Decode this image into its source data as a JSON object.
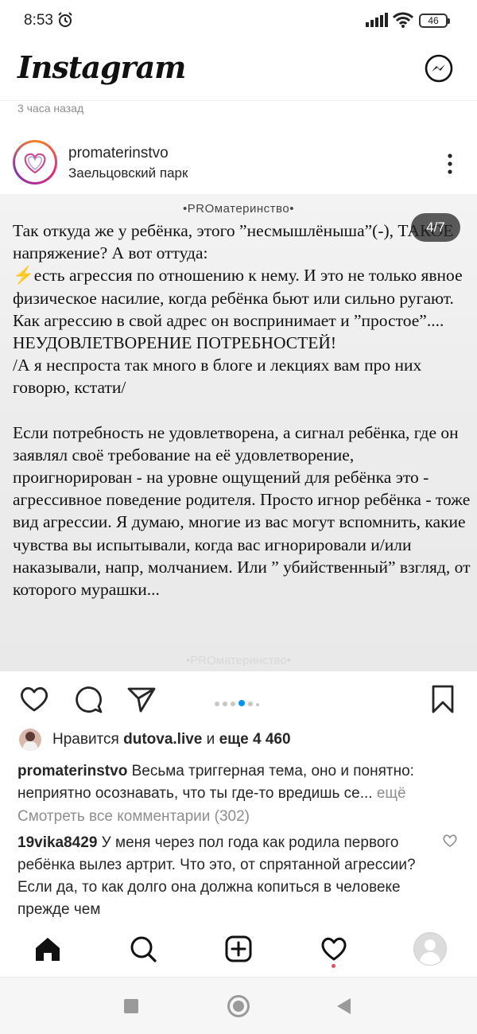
{
  "status_bar": {
    "time": "8:53",
    "battery": "46"
  },
  "header": {
    "app_name": "Instagram"
  },
  "post": {
    "time_ago": "3 часа назад",
    "username": "promaterinstvo",
    "location": "Заельцовский парк",
    "image": {
      "brand": "•PROматеринство•",
      "counter": "4/7",
      "paragraphs": [
        "Так откуда же у ребёнка, этого ”несмышлёныша”(-), ТАКОЕ напряжение? А вот оттуда:",
        "⚡есть агрессия по отношению к нему. И это не только явное физическое насилие, когда ребёнка бьют или сильно ругают. Как агрессию в свой адрес он воспринимает и ”простое”.... НЕУДОВЛЕТВОРЕНИЕ ПОТРЕБНОСТЕЙ!",
        "/А я неспроста так много в блоге и лекциях вам про них говорю, кстати/",
        "",
        "Если потребность не удовлетворена, а сигнал ребёнка, где он заявлял своё требование на её удовлетворение, проигнорирован - на уровне ощущений для ребёнка это - агрессивное поведение родителя. Просто игнор ребёнка - тоже вид агрессии. Я думаю, многие из вас могут вспомнить, какие чувства вы испытывали, когда вас игнорировали и/или наказывали, напр, молчанием. Или ” убийственный” взгляд, от которого мурашки..."
      ]
    },
    "likes": {
      "prefix": "Нравится",
      "user": "dutova.live",
      "conj": "и",
      "more": "еще 4 460"
    },
    "caption": {
      "username": "promaterinstvo",
      "text": "Весьма триггерная тема, оно и понятно: неприятно осознавать, что ты где-то вредишь се...",
      "more": "ещё"
    },
    "view_comments": "Смотреть все комментарии (302)",
    "comment": {
      "username": "19vika8429",
      "text": "У меня через пол года как родила первого ребёнка вылез артрит. Что это, от спрятанной агрессии? Если да, то как долго она должна копиться в человеке прежде чем"
    }
  },
  "colors": {
    "accent": "#0095f6",
    "notification": "#ed4956"
  }
}
